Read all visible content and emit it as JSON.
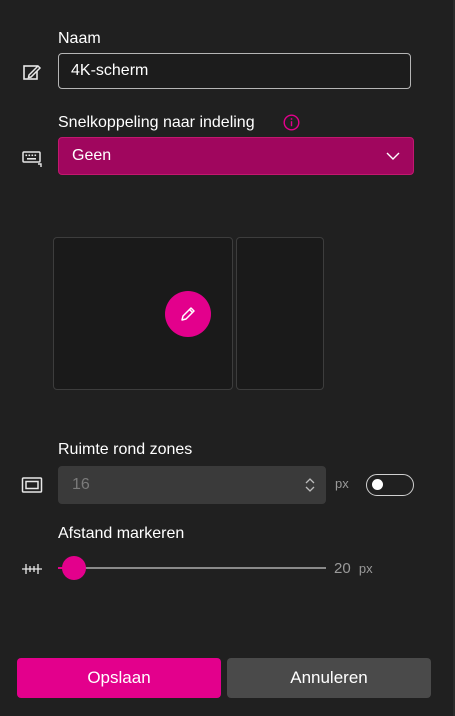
{
  "name_section": {
    "label": "Naam",
    "value": "4K-scherm"
  },
  "shortcut_section": {
    "label": "Snelkoppeling naar indeling",
    "selected": "Geen"
  },
  "spacing_section": {
    "label": "Ruimte rond zones",
    "value": "16",
    "unit": "px",
    "enabled": false
  },
  "highlight_section": {
    "label": "Afstand markeren",
    "value": "20",
    "unit": "px"
  },
  "buttons": {
    "save": "Opslaan",
    "cancel": "Annuleren"
  },
  "colors": {
    "accent": "#e3008c",
    "background": "#202020"
  },
  "icons": [
    "rename-icon",
    "keyboard-icon",
    "info-icon",
    "chevron-down-icon",
    "pencil-icon",
    "spacing-icon",
    "distance-icon",
    "spinner-icon"
  ]
}
